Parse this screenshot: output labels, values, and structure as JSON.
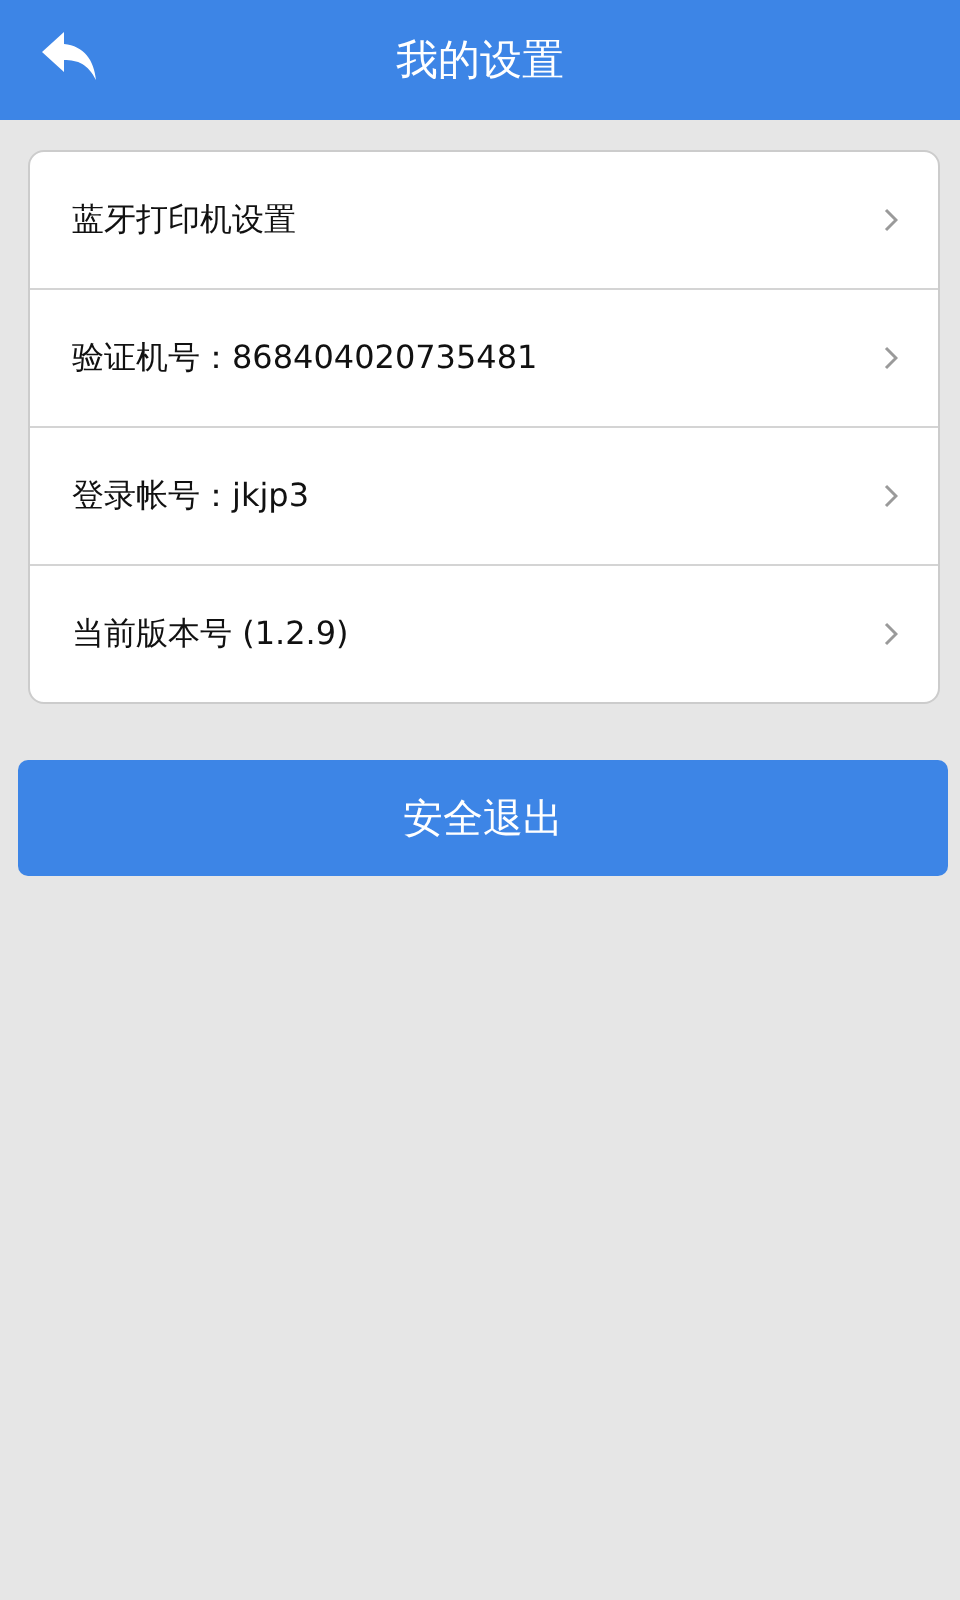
{
  "header": {
    "title": "我的设置"
  },
  "settings": [
    {
      "label": "蓝牙打印机设置"
    },
    {
      "label": "验证机号：868404020735481"
    },
    {
      "label": "登录帐号：jkjp3"
    },
    {
      "label": "当前版本号 (1.2.9)"
    }
  ],
  "logout_button": {
    "label": "安全退出"
  }
}
